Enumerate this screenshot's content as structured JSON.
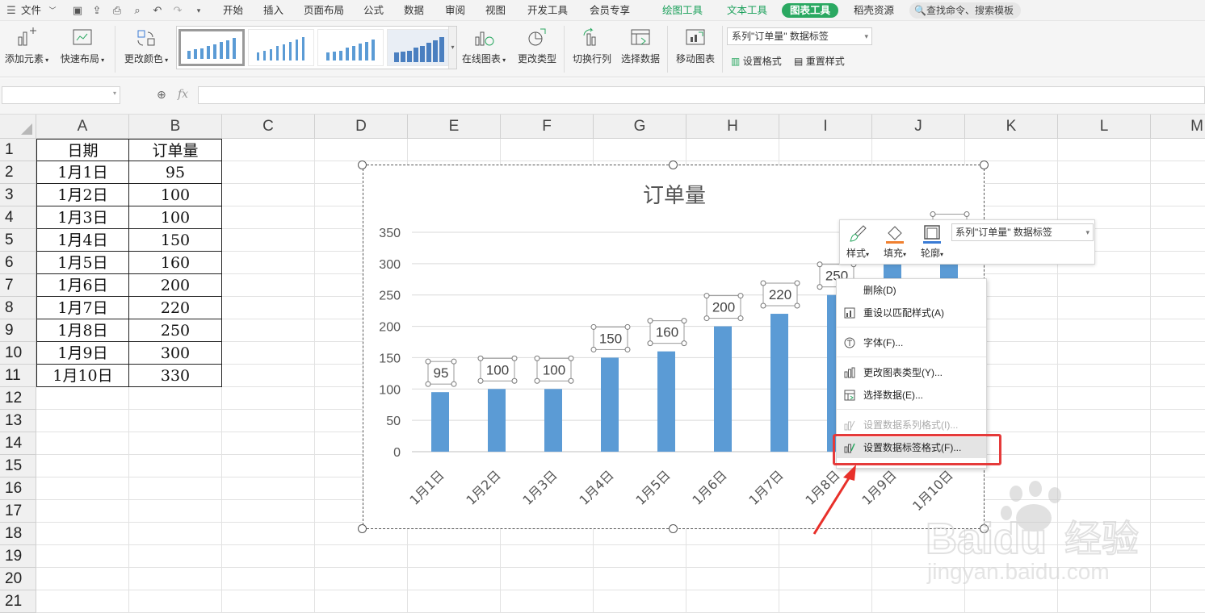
{
  "menubar": {
    "file_label": "文件",
    "tabs": [
      "开始",
      "插入",
      "页面布局",
      "公式",
      "数据",
      "审阅",
      "视图",
      "开发工具",
      "会员专享"
    ],
    "context_tabs": [
      "绘图工具",
      "文本工具",
      "图表工具"
    ],
    "active_tab": "图表工具",
    "resources_label": "稻壳资源",
    "search_placeholder": "查找命令、搜索模板"
  },
  "ribbon": {
    "add_element": "添加元素",
    "quick_layout": "快速布局",
    "change_color": "更改颜色",
    "online_chart": "在线图表",
    "change_type": "更改类型",
    "switch_row_col": "切换行列",
    "select_data": "选择数据",
    "move_chart": "移动图表",
    "series_select": "系列\"订单量\" 数据标签",
    "set_format": "设置格式",
    "reset_style": "重置样式"
  },
  "formula_bar": {
    "fx": "fx",
    "value": ""
  },
  "sheet": {
    "columns": [
      "A",
      "B",
      "C",
      "D",
      "E",
      "F",
      "G",
      "H",
      "I",
      "J",
      "K",
      "L",
      "M"
    ],
    "rows": [
      "1",
      "2",
      "3",
      "4",
      "5",
      "6",
      "7",
      "8",
      "9",
      "10",
      "11",
      "12",
      "13",
      "14",
      "15",
      "16",
      "17",
      "18",
      "19",
      "20",
      "21"
    ],
    "header": [
      "日期",
      "订单量"
    ],
    "data": [
      [
        "1月1日",
        "95"
      ],
      [
        "1月2日",
        "100"
      ],
      [
        "1月3日",
        "100"
      ],
      [
        "1月4日",
        "150"
      ],
      [
        "1月5日",
        "160"
      ],
      [
        "1月6日",
        "200"
      ],
      [
        "1月7日",
        "220"
      ],
      [
        "1月8日",
        "250"
      ],
      [
        "1月9日",
        "300"
      ],
      [
        "1月10日",
        "330"
      ]
    ]
  },
  "chart_data": {
    "type": "bar",
    "title": "订单量",
    "categories": [
      "1月1日",
      "1月2日",
      "1月3日",
      "1月4日",
      "1月5日",
      "1月6日",
      "1月7日",
      "1月8日",
      "1月9日",
      "1月10日"
    ],
    "values": [
      95,
      100,
      100,
      150,
      160,
      200,
      220,
      250,
      300,
      330
    ],
    "y_ticks": [
      "0",
      "50",
      "100",
      "150",
      "200",
      "250",
      "300",
      "350"
    ],
    "ylim": [
      0,
      350
    ],
    "grid": true,
    "bar_color": "#5b9bd5",
    "data_labels": true
  },
  "floatbar": {
    "style_label": "样式",
    "fill_label": "填充",
    "outline_label": "轮廓",
    "select_value": "系列\"订单量\" 数据标签"
  },
  "context_menu": {
    "items": [
      {
        "label": "删除(D)",
        "enabled": true
      },
      {
        "label": "重设以匹配样式(A)",
        "enabled": true
      },
      {
        "label": "字体(F)...",
        "enabled": true
      },
      {
        "label": "更改图表类型(Y)...",
        "enabled": true
      },
      {
        "label": "选择数据(E)...",
        "enabled": true
      },
      {
        "label": "设置数据系列格式(I)...",
        "enabled": false
      },
      {
        "label": "设置数据标签格式(F)...",
        "enabled": true
      }
    ]
  },
  "watermark": {
    "brand": "Baidu",
    "brand_cn": "经验",
    "url": "jingyan.baidu.com"
  },
  "colors": {
    "accent_green": "#2aa861",
    "bar": "#5b9bd5",
    "highlight_red": "#e53a3a",
    "arrow_red": "#e8302a"
  }
}
